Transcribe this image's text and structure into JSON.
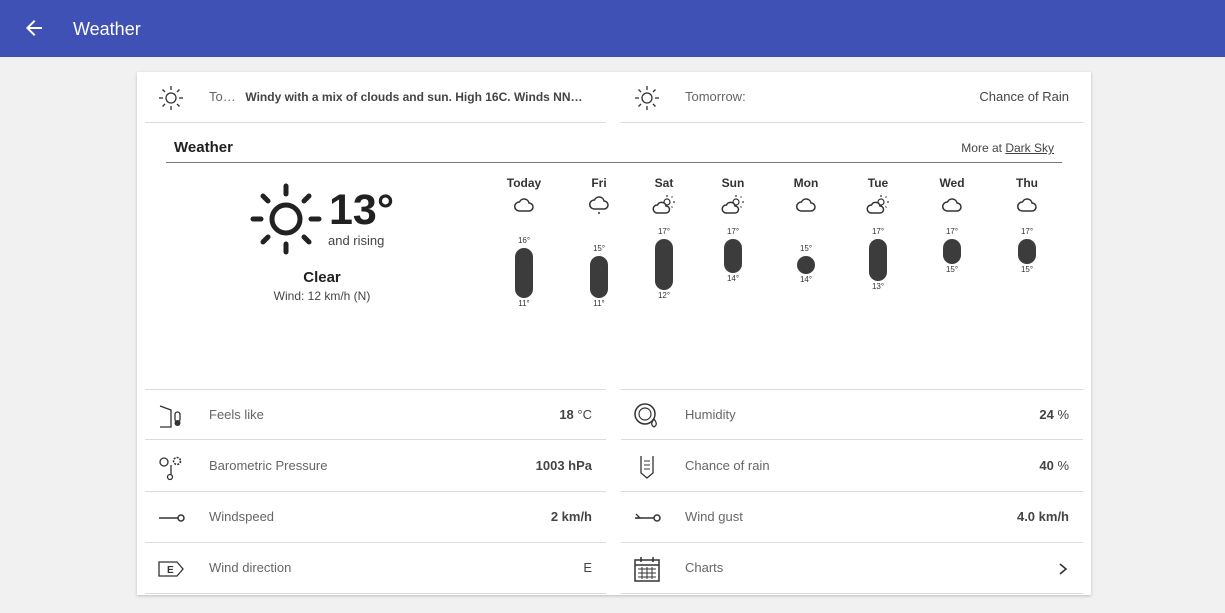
{
  "appbar": {
    "title": "Weather",
    "back_icon": "arrow-left-icon",
    "color": "#3f51b5"
  },
  "summary": {
    "today_label": "To…",
    "today_text": "Windy with a mix of clouds and sun. High 16C. Winds NN…",
    "tomorrow_label": "Tomorrow:",
    "tomorrow_text": "Chance of Rain"
  },
  "weather": {
    "title": "Weather",
    "more_prefix": "More at",
    "more_link": "Dark Sky",
    "current": {
      "temperature": "13°",
      "trend": "and rising",
      "condition": "Clear",
      "wind": "Wind: 12 km/h (N)"
    },
    "forecast": [
      {
        "day": "Today",
        "icon": "cloud-icon",
        "high": "16°",
        "low": "11°",
        "high_c": 16,
        "low_c": 11
      },
      {
        "day": "Fri",
        "icon": "rain-cloud-icon",
        "high": "15°",
        "low": "11°",
        "high_c": 15,
        "low_c": 11
      },
      {
        "day": "Sat",
        "icon": "partly-cloudy-icon",
        "high": "17°",
        "low": "12°",
        "high_c": 17,
        "low_c": 12
      },
      {
        "day": "Sun",
        "icon": "partly-cloudy-icon",
        "high": "17°",
        "low": "14°",
        "high_c": 17,
        "low_c": 14
      },
      {
        "day": "Mon",
        "icon": "cloud-icon",
        "high": "15°",
        "low": "14°",
        "high_c": 15,
        "low_c": 14
      },
      {
        "day": "Tue",
        "icon": "partly-cloudy-icon",
        "high": "17°",
        "low": "13°",
        "high_c": 17,
        "low_c": 13
      },
      {
        "day": "Wed",
        "icon": "cloud-icon",
        "high": "17°",
        "low": "15°",
        "high_c": 17,
        "low_c": 15
      },
      {
        "day": "Thu",
        "icon": "cloud-icon",
        "high": "17°",
        "low": "15°",
        "high_c": 17,
        "low_c": 15
      }
    ]
  },
  "stats": {
    "feels_like": {
      "label": "Feels like",
      "value": "18",
      "unit": "°C",
      "icon": "thermometer-icon"
    },
    "humidity": {
      "label": "Humidity",
      "value": "24",
      "unit": "%",
      "icon": "humidity-gauge-icon"
    },
    "pressure": {
      "label": "Barometric Pressure",
      "value": "1003 hPa",
      "icon": "barometer-icon"
    },
    "rain": {
      "label": "Chance of rain",
      "value": "40",
      "unit": "%",
      "icon": "rain-gauge-icon"
    },
    "windspeed": {
      "label": "Windspeed",
      "value": "2 km/h",
      "icon": "windspeed-icon"
    },
    "windgust": {
      "label": "Wind gust",
      "value": "4.0 km/h",
      "icon": "wind-gust-icon"
    },
    "winddir": {
      "label": "Wind direction",
      "value": "E",
      "icon": "wind-direction-icon",
      "badge": "E"
    },
    "charts": {
      "label": "Charts",
      "icon": "calendar-icon",
      "chevron": "chevron-right-icon"
    }
  }
}
